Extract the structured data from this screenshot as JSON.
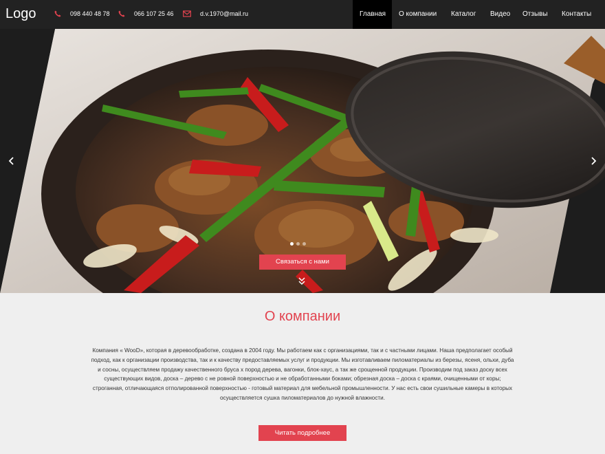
{
  "header": {
    "logo": "Logo",
    "phone1": "098 440 48 78",
    "phone2": "066 107 25 46",
    "email": "d.v.1970@mail.ru",
    "nav": [
      "Главная",
      "О компании",
      "Каталог",
      "Видео",
      "Отзывы",
      "Контакты"
    ],
    "accent_color": "#e2434f"
  },
  "hero": {
    "cta_label": "Связаться с нами",
    "slides_total": 3,
    "active_slide": 1,
    "prev_icon": "chevron-left-icon",
    "next_icon": "chevron-right-icon"
  },
  "about": {
    "title": "О компании",
    "text": "Компания « WooD», которая в деревообработке, создана в 2004 году. Мы работаем как с организациями, так и с частными лицами. Наша предполагает особый подход, как к организации производства, так и к качеству предоставляемых услуг и продукции. Мы изготавливаем пиломатериалы из березы, ясеня, ольхи, дуба и сосны, осуществляем продажу качественного бруса х пород дерева, вагонки, блок-хаус, а так же срощенной продукции. Производим под заказ доску всех существующих видов, доска – дерево с не ровной поверхностью и не обработанными боками; обрезная доска – доска с краями, очищенными от коры; строганная, отличающаяся отполированной поверхностью - готовый материал для мебельной промышленности. У нас есть свои сушильные камеры в которых осуществляется сушка пиломатериалов до нужной влажности.",
    "more_label": "Читать подробнее"
  }
}
